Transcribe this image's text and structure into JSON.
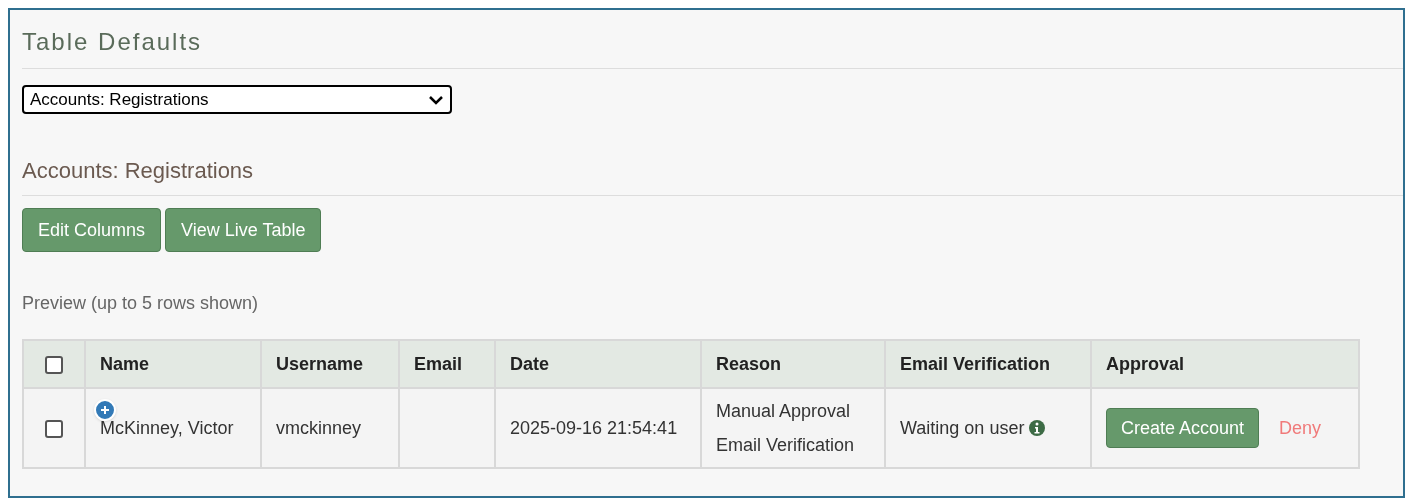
{
  "title": "Table Defaults",
  "table_select": {
    "value": "Accounts: Registrations"
  },
  "section_title": "Accounts: Registrations",
  "buttons": [
    "Edit Columns",
    "View Live Table"
  ],
  "preview_note": "Preview (up to 5 rows shown)",
  "table": {
    "select_all": {
      "checked": false
    },
    "columns": [
      "Name",
      "Username",
      "Email",
      "Date",
      "Reason",
      "Email Verification",
      "Approval"
    ],
    "rows": [
      {
        "checked": false,
        "expandable": true,
        "name": "McKinney, Victor",
        "username": "vmckinney",
        "date": "2025-09-16 21:54:41",
        "reason": [
          "Manual Approval",
          "Email Verification"
        ],
        "email_verification": "Waiting on user",
        "approve_button": "Create Account",
        "deny_link": "Deny"
      }
    ]
  }
}
